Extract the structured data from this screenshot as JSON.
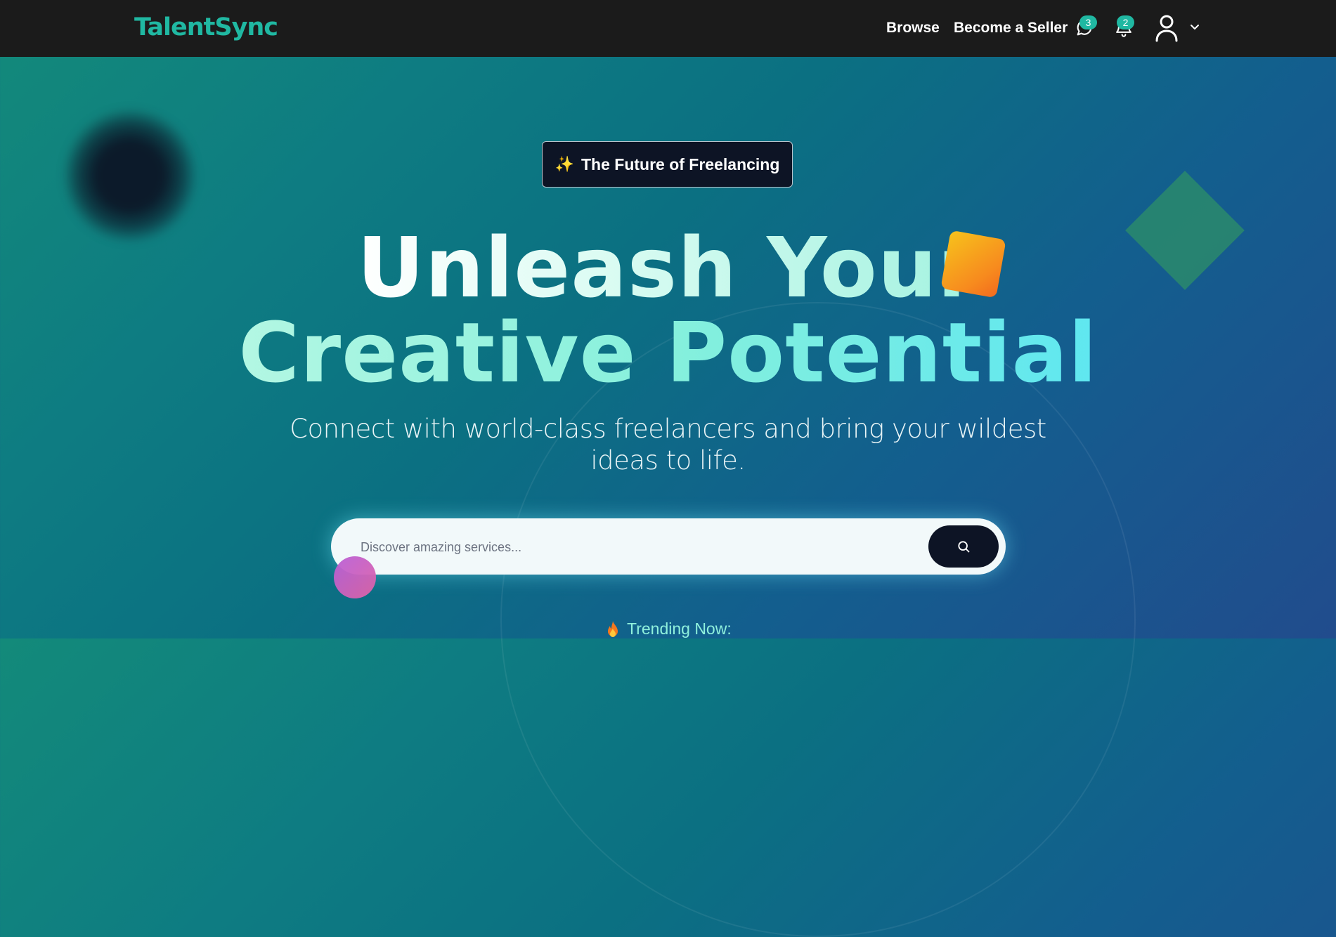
{
  "navbar": {
    "logo": "TalentSync",
    "links": {
      "browse": "Browse",
      "become_seller": "Become a Seller"
    },
    "messages": {
      "icon": "chat-icon",
      "count": "3"
    },
    "notifications": {
      "icon": "bell-icon",
      "count": "2"
    },
    "account": {
      "icon": "user-icon",
      "dropdown_icon": "chevron-down-icon"
    }
  },
  "hero": {
    "badge": {
      "icon": "sparkles-icon",
      "label": "The Future of Freelancing"
    },
    "headline_line1": "Unleash Your",
    "headline_line2": "Creative Potential",
    "subtitle": "Connect with world-class freelancers and bring your wildest ideas to life.",
    "search": {
      "placeholder": "Discover amazing services...",
      "button_icon": "search-icon"
    },
    "trending": {
      "icon": "fire-icon",
      "label": "Trending Now:"
    }
  },
  "colors": {
    "brand": "#20b8a2",
    "navbar_bg": "#1b1b1b",
    "dark_navy": "#0d1425",
    "accent_orange": "#f78a1e"
  }
}
